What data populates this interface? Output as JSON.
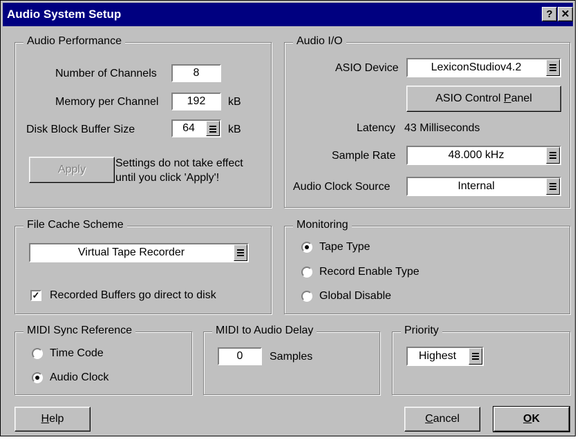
{
  "window": {
    "title": "Audio System Setup",
    "help_glyph": "?",
    "close_glyph": "✕"
  },
  "audio_performance": {
    "legend": "Audio Performance",
    "channels_label": "Number of Channels",
    "channels_value": "8",
    "memory_label": "Memory per Channel",
    "memory_value": "192",
    "memory_unit": "kB",
    "disk_label": "Disk Block Buffer Size",
    "disk_value": "64",
    "disk_unit": "kB",
    "apply_label": "Apply",
    "note_line1": "Settings do not take effect",
    "note_line2": "until you click 'Apply'!"
  },
  "audio_io": {
    "legend": "Audio I/O",
    "asio_label": "ASIO Device",
    "asio_value": "LexiconStudiov4.2",
    "control_panel_pre": "ASIO Control ",
    "control_panel_key": "P",
    "control_panel_post": "anel",
    "latency_label": "Latency",
    "latency_value": "43 Milliseconds",
    "sample_rate_label": "Sample Rate",
    "sample_rate_value": "48.000 kHz",
    "clock_source_label": "Audio Clock Source",
    "clock_source_value": "Internal"
  },
  "file_cache": {
    "legend": "File Cache Scheme",
    "scheme_value": "Virtual Tape Recorder",
    "direct_label": "Recorded Buffers go direct to disk",
    "direct_checked": true
  },
  "monitoring": {
    "legend": "Monitoring",
    "options": [
      "Tape Type",
      "Record Enable Type",
      "Global Disable"
    ],
    "selected": "Tape Type"
  },
  "midi_sync": {
    "legend": "MIDI Sync Reference",
    "options": [
      "Time Code",
      "Audio Clock"
    ],
    "selected": "Audio Clock"
  },
  "midi_delay": {
    "legend": "MIDI to Audio Delay",
    "value": "0",
    "unit": "Samples"
  },
  "priority": {
    "legend": "Priority",
    "value": "Highest"
  },
  "buttons": {
    "help_key": "H",
    "help_rest": "elp",
    "cancel_key": "C",
    "cancel_rest": "ancel",
    "ok_key": "O",
    "ok_rest": "K"
  }
}
